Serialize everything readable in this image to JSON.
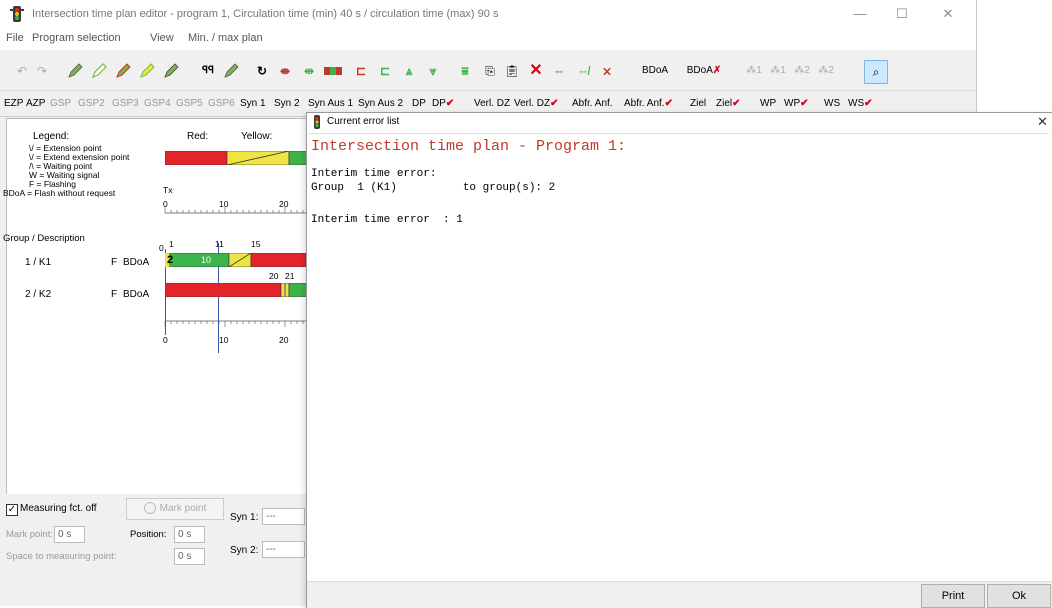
{
  "window": {
    "title": "Intersection time plan editor - program 1, Circulation time (min) 40 s / circulation time (max) 90 s",
    "minimize_glyph": "—",
    "maximize_glyph": "☐",
    "close_glyph": "✕"
  },
  "menu": [
    "File",
    "Program selection",
    "View",
    "Min. / max plan"
  ],
  "toolbar": {
    "bdoa_label": "BDoA",
    "bdoa_x_label": "BDoA",
    "group_labels": [
      "1",
      "1",
      "2",
      "2"
    ]
  },
  "tabs": [
    "EZP",
    "AZP",
    "GSP",
    "GSP2",
    "GSP3",
    "GSP4",
    "GSP5",
    "GSP6",
    "Syn 1",
    "Syn 2",
    "Syn Aus 1",
    "Syn Aus 2",
    "DP",
    "DP",
    "Verl. DZ",
    "Verl. DZ",
    "Abfr. Anf.",
    "Abfr. Anf.",
    "Ziel",
    "Ziel",
    "WP",
    "WP",
    "WS",
    "WS"
  ],
  "legend": {
    "title": "Legend:",
    "red_label": "Red:",
    "yellow_label": "Yellow:",
    "items": [
      "\\/ = Extension point",
      "\\/ = Extend extension point",
      "/\\ = Waiting point",
      "W = Waiting signal",
      "F = Flashing",
      "BDoA = Flash without request"
    ],
    "tx_label": "Tx"
  },
  "axis": {
    "top_ticks": [
      "0",
      "10",
      "20"
    ],
    "group_ticks": [
      "0",
      "1",
      "11",
      "15"
    ],
    "bottom_ticks": [
      "0",
      "10",
      "20"
    ],
    "row2_ticks": [
      "20",
      "21"
    ]
  },
  "groups_header": "Group / Description",
  "groups": [
    {
      "name": "1 / K1",
      "flag": "F",
      "mode": "BDoA",
      "marker": "2",
      "green_label": "10"
    },
    {
      "name": "2 / K2",
      "flag": "F",
      "mode": "BDoA"
    }
  ],
  "bottom_panel": {
    "measuring_label": "Measuring fct. off",
    "mark_point_button": "Mark point",
    "mark_point_label": "Mark point:",
    "mark_point_value": "0 s",
    "position_label": "Position:",
    "position_value": "0 s",
    "space_label": "Space to measuring point:",
    "space_value": "0 s",
    "syn1_label": "Syn 1:",
    "syn1_value": "---",
    "syn2_label": "Syn 2:",
    "syn2_value": "---"
  },
  "dialog": {
    "title": "Current error list",
    "close_glyph": "✕",
    "heading": "Intersection time plan - Program 1:",
    "lines": [
      "Interim time error:",
      "Group  1 (K1)          to group(s): 2",
      "",
      "Interim time error  : 1"
    ],
    "print_button": "Print",
    "ok_button": "Ok"
  },
  "colors": {
    "red": "#e3242b",
    "green": "#3cb44b",
    "yellow": "#f0e442",
    "heading": "#c0392b",
    "icon_green": "#7ab648"
  }
}
